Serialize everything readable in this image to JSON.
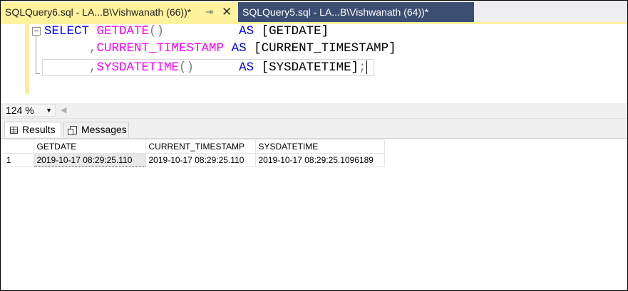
{
  "tabs": [
    {
      "title": "SQLQuery6.sql - LA...B\\Vishwanath (66))*",
      "pin_icon": "pin-icon",
      "close_icon": "close-icon",
      "active": true
    },
    {
      "title": "SQLQuery5.sql - LA...B\\Vishwanath (64))*",
      "active": false
    }
  ],
  "editor": {
    "lines": [
      {
        "prefix": "",
        "keyword": "SELECT",
        "func": "GETDATE",
        "parens": "()",
        "pad": "          ",
        "as": "AS",
        "alias": "[GETDATE]",
        "suffix": ""
      },
      {
        "prefix": "      ,",
        "keyword": "",
        "func": "CURRENT_TIMESTAMP",
        "parens": "",
        "pad": " ",
        "as": "AS",
        "alias": "[CURRENT_TIMESTAMP]",
        "suffix": ""
      },
      {
        "prefix": "      ,",
        "keyword": "",
        "func": "SYSDATETIME",
        "parens": "()",
        "pad": "      ",
        "as": "AS",
        "alias": "[SYSDATETIME]",
        "suffix": ";"
      }
    ]
  },
  "zoom": {
    "value": "124 %"
  },
  "results_tabs": {
    "results_label": "Results",
    "messages_label": "Messages"
  },
  "grid": {
    "columns": [
      "GETDATE",
      "CURRENT_TIMESTAMP",
      "SYSDATETIME"
    ],
    "rows": [
      {
        "num": "1",
        "cells": [
          "2019-10-17 08:29:25.110",
          "2019-10-17 08:29:25.110",
          "2019-10-17 08:29:25.1096189"
        ]
      }
    ]
  },
  "colors": {
    "active_tab": "#fff29d",
    "inactive_tab": "#3d4e73",
    "keyword": "#0000ff",
    "function": "#ff00ff",
    "operator": "#808080"
  }
}
